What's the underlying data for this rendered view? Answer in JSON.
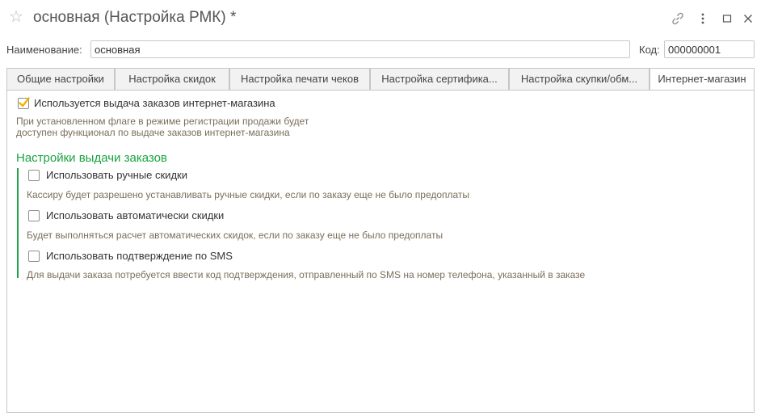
{
  "window": {
    "title": "основная (Настройка РМК) *",
    "colors": {
      "accent_green": "#1aa33f",
      "hint_brown": "#7a6e5a",
      "check_orange": "#f2b400"
    }
  },
  "form": {
    "name_label": "Наименование:",
    "name_value": "основная",
    "code_label": "Код:",
    "code_value": "000000001"
  },
  "tabs": [
    {
      "label": "Общие настройки",
      "active": false
    },
    {
      "label": "Настройка скидок",
      "active": false
    },
    {
      "label": "Настройка печати чеков",
      "active": false
    },
    {
      "label": "Настройка сертифика...",
      "active": false
    },
    {
      "label": "Настройка скупки/обм...",
      "active": false
    },
    {
      "label": "Интернет-магазин",
      "active": true
    }
  ],
  "online_store": {
    "main_checkbox": {
      "label": "Используется выдача заказов интернет-магазина",
      "checked": true,
      "hint_line1": "При установленном флаге в режиме регистрации продажи будет",
      "hint_line2": "доступен функционал по выдаче заказов интернет-магазина"
    },
    "section_title": "Настройки выдачи заказов",
    "options": [
      {
        "label": "Использовать ручные скидки",
        "checked": false,
        "hint": "Кассиру будет разрешено устанавливать ручные скидки, если по заказу еще не было предоплаты"
      },
      {
        "label": "Использовать автоматически скидки",
        "checked": false,
        "hint": "Будет выполняться расчет автоматических скидок, если по заказу еще не было предоплаты"
      },
      {
        "label": "Использовать подтверждение по SMS",
        "checked": false,
        "hint": "Для выдачи заказа потребуется ввести код подтверждения, отправленный по SMS на номер телефона, указанный в заказе"
      }
    ]
  }
}
